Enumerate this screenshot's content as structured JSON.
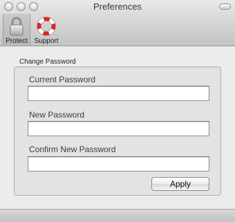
{
  "window": {
    "title": "Preferences"
  },
  "toolbar": {
    "items": [
      {
        "label": "Protect",
        "icon": "lock-icon",
        "selected": true
      },
      {
        "label": "Support",
        "icon": "lifebuoy-icon",
        "selected": false
      }
    ]
  },
  "change_password": {
    "group_title": "Change Password",
    "fields": [
      {
        "label": "Current Password",
        "value": ""
      },
      {
        "label": "New Password",
        "value": ""
      },
      {
        "label": "Confirm New Password",
        "value": ""
      }
    ],
    "apply_label": "Apply"
  },
  "colors": {
    "lifebuoy_red": "#e0261e",
    "window_background": "#ececec"
  }
}
